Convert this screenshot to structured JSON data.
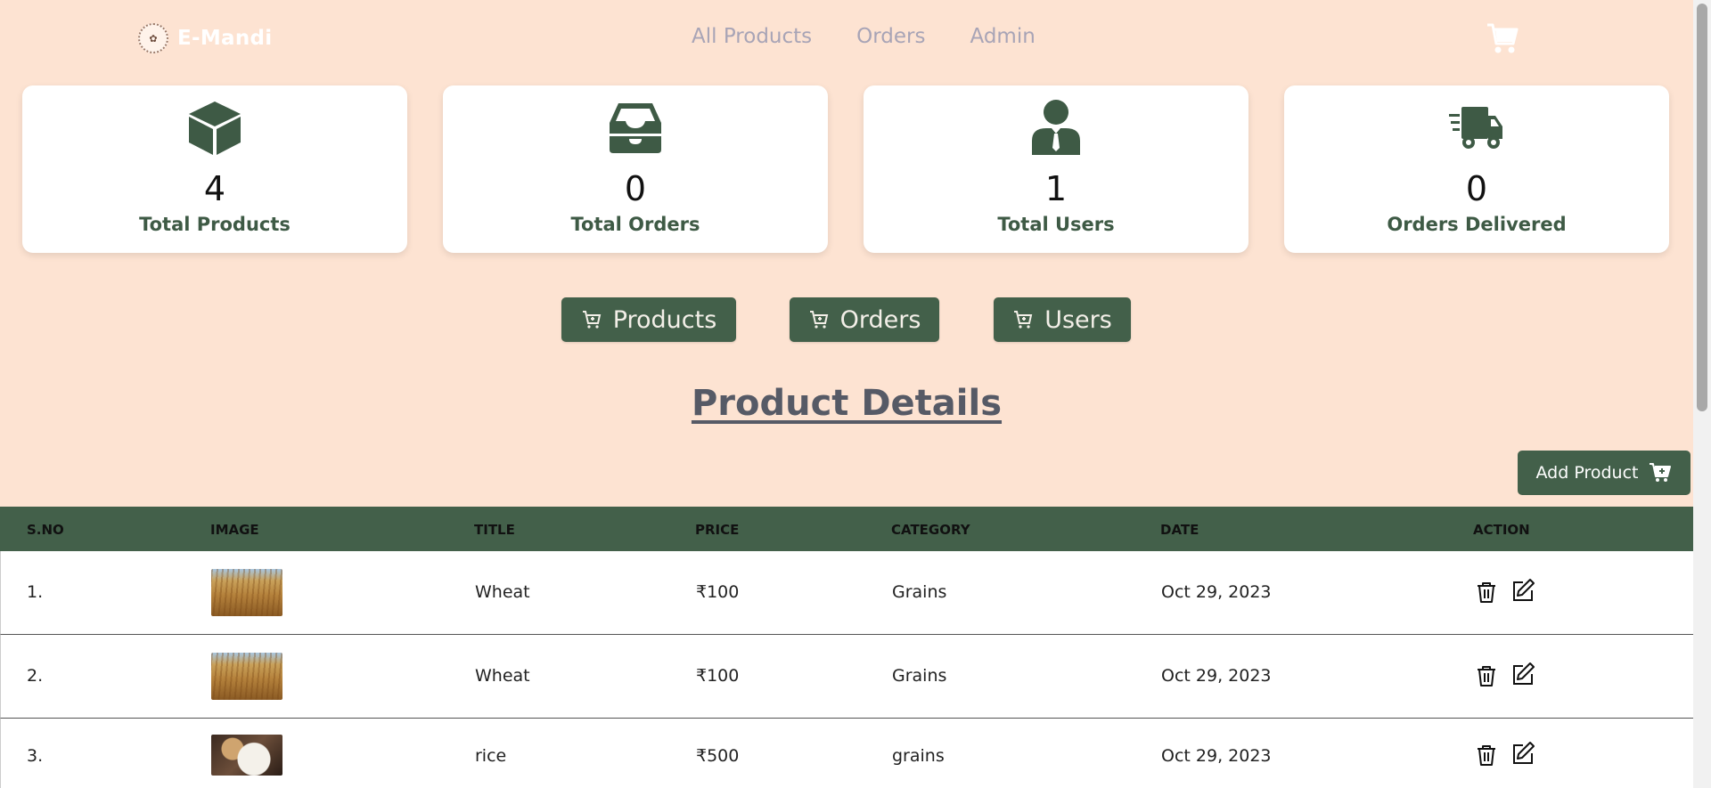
{
  "brand": {
    "name": "E-Mandi"
  },
  "nav": {
    "links": [
      "All Products",
      "Orders",
      "Admin"
    ]
  },
  "stats": [
    {
      "value": "4",
      "label": "Total Products",
      "icon": "box-icon"
    },
    {
      "value": "0",
      "label": "Total Orders",
      "icon": "inbox-icon"
    },
    {
      "value": "1",
      "label": "Total Users",
      "icon": "user-icon"
    },
    {
      "value": "0",
      "label": "Orders Delivered",
      "icon": "truck-icon"
    }
  ],
  "tabs": {
    "products": "Products",
    "orders": "Orders",
    "users": "Users"
  },
  "section": {
    "title": "Product Details",
    "add_button": "Add Product"
  },
  "table": {
    "headers": [
      "S.NO",
      "IMAGE",
      "TITLE",
      "PRICE",
      "CATEGORY",
      "DATE",
      "ACTION"
    ],
    "rows": [
      {
        "sno": "1.",
        "image": "wheat",
        "title": "Wheat",
        "price": "₹100",
        "category": "Grains",
        "date": "Oct 29, 2023"
      },
      {
        "sno": "2.",
        "image": "wheat",
        "title": "Wheat",
        "price": "₹100",
        "category": "Grains",
        "date": "Oct 29, 2023"
      },
      {
        "sno": "3.",
        "image": "rice",
        "title": "rice",
        "price": "₹500",
        "category": "grains",
        "date": "Oct 29, 2023"
      }
    ]
  },
  "colors": {
    "background": "#fde3d2",
    "primary": "#43604a",
    "label": "#3e5a45",
    "nav_link": "#a8a4b6"
  }
}
